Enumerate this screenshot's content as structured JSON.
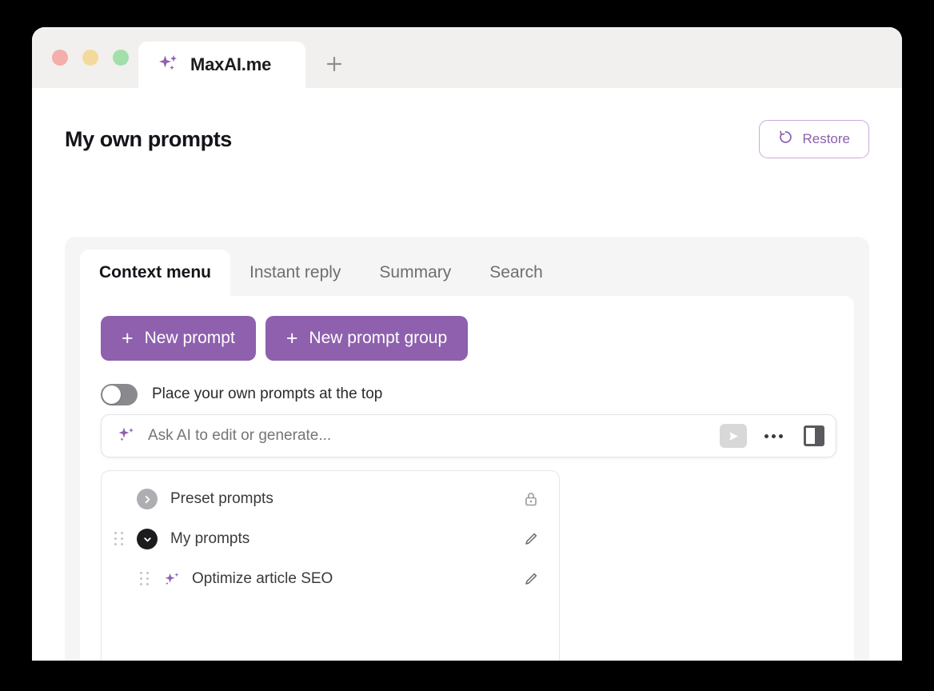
{
  "browser": {
    "traffic_lights": [
      "close",
      "minimize",
      "maximize"
    ],
    "tab": {
      "title": "MaxAI.me",
      "icon": "sparkle-icon"
    },
    "new_tab_label": "+"
  },
  "header": {
    "title": "My own prompts",
    "restore_button": {
      "label": "Restore",
      "icon": "restore-icon",
      "color": "#8b5fad"
    }
  },
  "tabs": [
    {
      "label": "Context menu",
      "active": true
    },
    {
      "label": "Instant reply",
      "active": false
    },
    {
      "label": "Summary",
      "active": false
    },
    {
      "label": "Search",
      "active": false
    }
  ],
  "actions": {
    "new_prompt": {
      "label": "New prompt",
      "icon": "plus-icon"
    },
    "new_prompt_group": {
      "label": "New prompt group",
      "icon": "plus-icon"
    },
    "accent_color": "#8e60ad"
  },
  "toggle": {
    "label": "Place your own prompts at the top",
    "state": "off"
  },
  "ai_input": {
    "placeholder": "Ask AI to edit or generate...",
    "value": "",
    "leading_icon": "sparkle-icon",
    "send_icon": "send-icon",
    "more_icon": "more-horizontal-icon",
    "panel_icon": "side-panel-icon"
  },
  "prompt_list": [
    {
      "label": "Preset prompts",
      "toggle_icon": "chevron-right-icon",
      "toggle_style": "gray",
      "trailing_icon": "lock-icon",
      "draggable": false,
      "child": false
    },
    {
      "label": "My prompts",
      "toggle_icon": "chevron-down-icon",
      "toggle_style": "black",
      "trailing_icon": "pencil-icon",
      "draggable": true,
      "child": false
    },
    {
      "label": "Optimize article SEO",
      "toggle_icon": "sparkle-icon",
      "toggle_style": "sparkle",
      "trailing_icon": "pencil-icon",
      "draggable": true,
      "child": true
    }
  ]
}
